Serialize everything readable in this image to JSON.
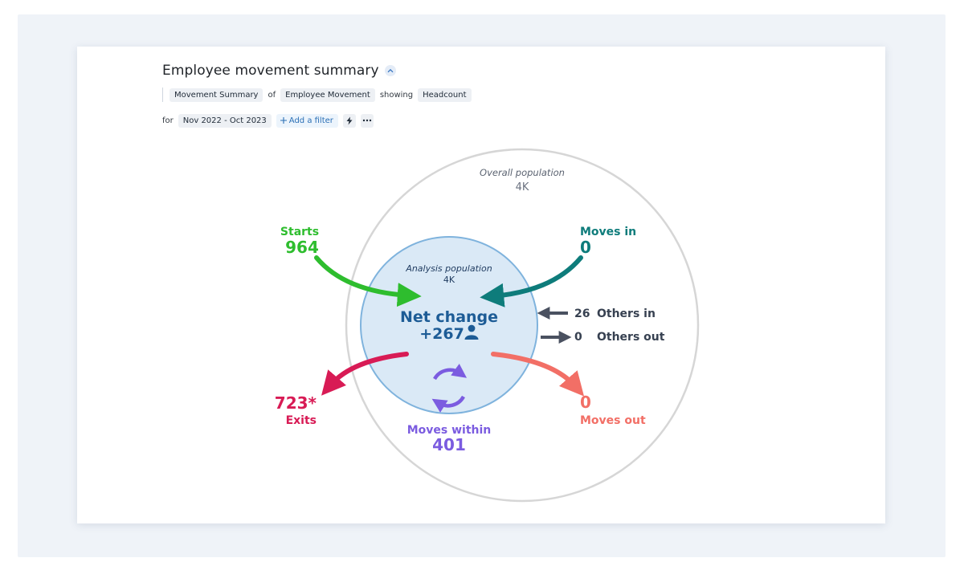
{
  "header": {
    "title": "Employee movement summary"
  },
  "query": {
    "view": "Movement Summary",
    "of_word": "of",
    "subject": "Employee Movement",
    "showing_word": "showing",
    "measure": "Headcount"
  },
  "filters": {
    "for_word": "for",
    "date_range": "Nov 2022 - Oct 2023",
    "add_filter_label": "Add a filter"
  },
  "diagram": {
    "overall": {
      "label": "Overall population",
      "value": "4K"
    },
    "analysis": {
      "label": "Analysis population",
      "value": "4K"
    },
    "net_change": {
      "label": "Net change",
      "value": "+267"
    },
    "starts": {
      "label": "Starts",
      "value": "964"
    },
    "moves_in": {
      "label": "Moves in",
      "value": "0"
    },
    "others_in": {
      "label": "Others in",
      "value": "26"
    },
    "others_out": {
      "label": "Others out",
      "value": "0"
    },
    "exits": {
      "label": "Exits",
      "value": "723*"
    },
    "moves_within": {
      "label": "Moves within",
      "value": "401"
    },
    "moves_out": {
      "label": "Moves out",
      "value": "0"
    }
  },
  "colors": {
    "starts": "#2ebd2e",
    "moves_in": "#0e7c7b",
    "exits": "#d81b55",
    "moves_out": "#f26f66",
    "moves_within": "#7b5ce0",
    "net_change": "#1d5c96",
    "others_arrow": "#4a5160"
  }
}
